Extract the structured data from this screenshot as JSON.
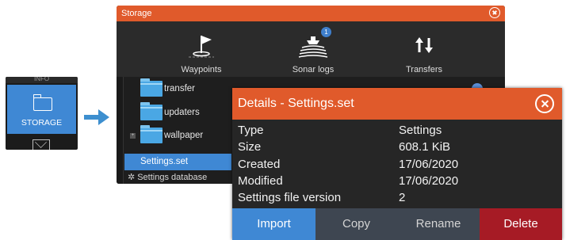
{
  "thumbnail": {
    "top_text": "INFO",
    "selected_label": "STORAGE",
    "folder_icon": "folder-icon",
    "mail_icon": "mail-icon"
  },
  "storage_window": {
    "title": "Storage",
    "toolbar": [
      {
        "label": "Waypoints",
        "icon": "waypoint-flag-icon"
      },
      {
        "label": "Sonar logs",
        "icon": "sonar-boat-icon",
        "badge": "1"
      },
      {
        "label": "Transfers",
        "icon": "transfer-arrows-icon"
      }
    ],
    "files": [
      {
        "name": "transfer"
      },
      {
        "name": "updaters"
      },
      {
        "name": "wallpaper",
        "expander": "+"
      }
    ],
    "selected_file": "Settings.set",
    "db_item": "Settings database"
  },
  "details_dialog": {
    "title": "Details - Settings.set",
    "rows": [
      {
        "key": "Type",
        "value": "Settings"
      },
      {
        "key": "Size",
        "value": "608.1 KiB"
      },
      {
        "key": "Created",
        "value": "17/06/2020"
      },
      {
        "key": "Modified",
        "value": "17/06/2020"
      },
      {
        "key": "Settings file version",
        "value": "2"
      }
    ],
    "buttons": {
      "import": "Import",
      "copy": "Copy",
      "rename": "Rename",
      "delete": "Delete"
    }
  },
  "colors": {
    "title_bar": "#e05a2b",
    "selection": "#3f88d4",
    "delete": "#a61b25",
    "arrow": "#3d8fcf"
  }
}
